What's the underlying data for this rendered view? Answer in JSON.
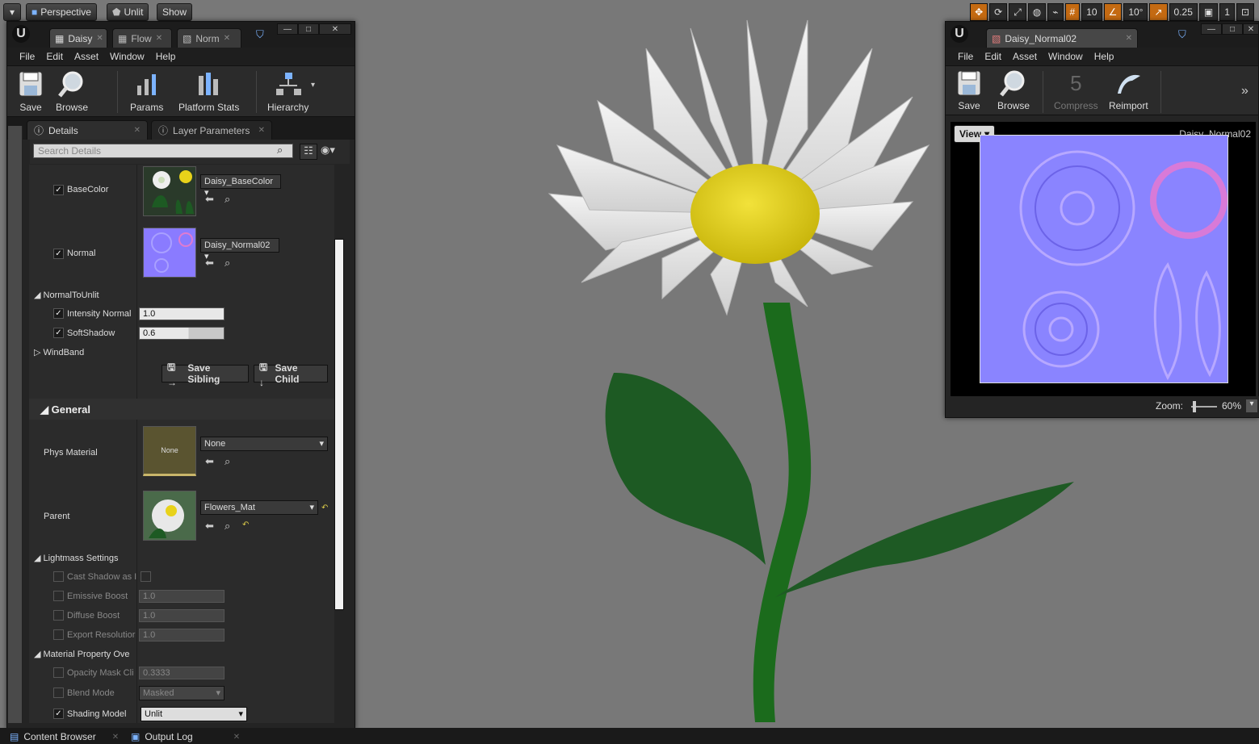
{
  "viewport": {
    "perspective_label": "Perspective",
    "unlit_label": "Unlit",
    "show_label": "Show",
    "grid_snap": "10",
    "rot_snap": "10°",
    "scale_snap": "0.25",
    "camera_speed": "1"
  },
  "material_editor": {
    "tabs": [
      "Daisy",
      "Flow",
      "Norm"
    ],
    "menu": [
      "File",
      "Edit",
      "Asset",
      "Window",
      "Help"
    ],
    "toolbar": {
      "save": "Save",
      "browse": "Browse",
      "params": "Params",
      "platform_stats": "Platform Stats",
      "hierarchy": "Hierarchy"
    },
    "panel_tabs": {
      "details": "Details",
      "layer_parameters": "Layer Parameters"
    },
    "search_placeholder": "Search Details",
    "params": {
      "basecolor_label": "BaseColor",
      "basecolor_texture": "Daisy_BaseColor",
      "normal_label": "Normal",
      "normal_texture": "Daisy_Normal02",
      "group_normal_to_unlit": "NormalToUnlit",
      "intensity_normal_label": "Intensity Normal",
      "intensity_normal_value": "1.0",
      "softshadow_label": "SoftShadow",
      "softshadow_value": "0.6",
      "group_windband": "WindBand",
      "save_sibling": "Save Sibling",
      "save_child": "Save Child"
    },
    "general": {
      "section": "General",
      "phys_material_label": "Phys Material",
      "phys_material_value": "None",
      "phys_thumb_text": "None",
      "parent_label": "Parent",
      "parent_value": "Flowers_Mat"
    },
    "lightmass": {
      "section": "Lightmass Settings",
      "cast_shadow_label": "Cast Shadow as I",
      "emissive_boost_label": "Emissive Boost",
      "emissive_boost_value": "1.0",
      "diffuse_boost_label": "Diffuse Boost",
      "diffuse_boost_value": "1.0",
      "export_resolution_label": "Export Resolutior",
      "export_resolution_value": "1.0"
    },
    "material_property": {
      "section": "Material Property Ove",
      "opacity_mask_label": "Opacity Mask Cli",
      "opacity_mask_value": "0.3333",
      "blend_mode_label": "Blend Mode",
      "blend_mode_value": "Masked",
      "shading_model_label": "Shading Model",
      "shading_model_value": "Unlit"
    }
  },
  "texture_editor": {
    "tab": "Daisy_Normal02",
    "menu": [
      "File",
      "Edit",
      "Asset",
      "Window",
      "Help"
    ],
    "toolbar": {
      "save": "Save",
      "browse": "Browse",
      "compress": "Compress",
      "reimport": "Reimport"
    },
    "view_label": "View",
    "texture_name": "Daisy_Normal02",
    "zoom_label": "Zoom:",
    "zoom_value": "60%"
  },
  "statusbar": {
    "content_browser": "Content Browser",
    "output_log": "Output Log"
  },
  "colors": {
    "accent_orange": "#c46a12",
    "petal": "#e6e6e6",
    "center": "#e8d21a",
    "stem": "#1a6a1a",
    "normal_map": "#8080ff"
  }
}
